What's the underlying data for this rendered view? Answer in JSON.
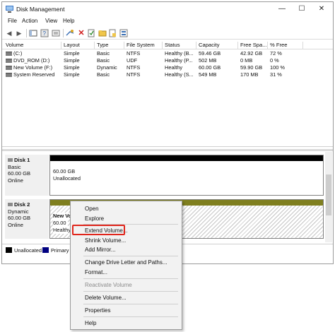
{
  "window": {
    "title": "Disk Management",
    "minimize": "—",
    "maximize": "☐",
    "close": "✕"
  },
  "menu": [
    "File",
    "Action",
    "View",
    "Help"
  ],
  "volumes": {
    "columns": [
      "Volume",
      "Layout",
      "Type",
      "File System",
      "Status",
      "Capacity",
      "Free Spa...",
      "% Free"
    ],
    "rows": [
      [
        "(C:)",
        "Simple",
        "Basic",
        "NTFS",
        "Healthy (B...",
        "59.46 GB",
        "42.92 GB",
        "72 %"
      ],
      [
        "DVD_ROM (D:)",
        "Simple",
        "Basic",
        "UDF",
        "Healthy (P...",
        "502 MB",
        "0 MB",
        "0 %"
      ],
      [
        "New Volume (F:)",
        "Simple",
        "Dynamic",
        "NTFS",
        "Healthy",
        "60.00 GB",
        "59.90 GB",
        "100 %"
      ],
      [
        "System Reserved",
        "Simple",
        "Basic",
        "NTFS",
        "Healthy (S...",
        "549 MB",
        "170 MB",
        "31 %"
      ]
    ]
  },
  "disks": [
    {
      "name": "Disk 1",
      "type": "Basic",
      "size": "60.00 GB",
      "state": "Online",
      "partition_size": "60.00 GB",
      "partition_status": "Unallocated"
    },
    {
      "name": "Disk 2",
      "type": "Dynamic",
      "size": "60.00 GB",
      "state": "Online",
      "partition_name": "New Vo",
      "partition_size": "60.00",
      "partition_status": "Healthy"
    }
  ],
  "legend": {
    "unallocated": "Unallocated",
    "primary": "Primary p"
  },
  "context_menu": {
    "open": "Open",
    "explore": "Explore",
    "extend": "Extend Volume...",
    "shrink": "Shrink Volume...",
    "add_mirror": "Add Mirror...",
    "change_letter": "Change Drive Letter and Paths...",
    "format": "Format...",
    "reactivate": "Reactivate Volume",
    "delete": "Delete Volume...",
    "properties": "Properties",
    "help": "Help"
  },
  "colors": {
    "unallocated_bar": "#000000",
    "simple_volume_bar": "#7f7f1f",
    "primary_swatch": "#000080",
    "highlight_border": "#e0251b"
  }
}
